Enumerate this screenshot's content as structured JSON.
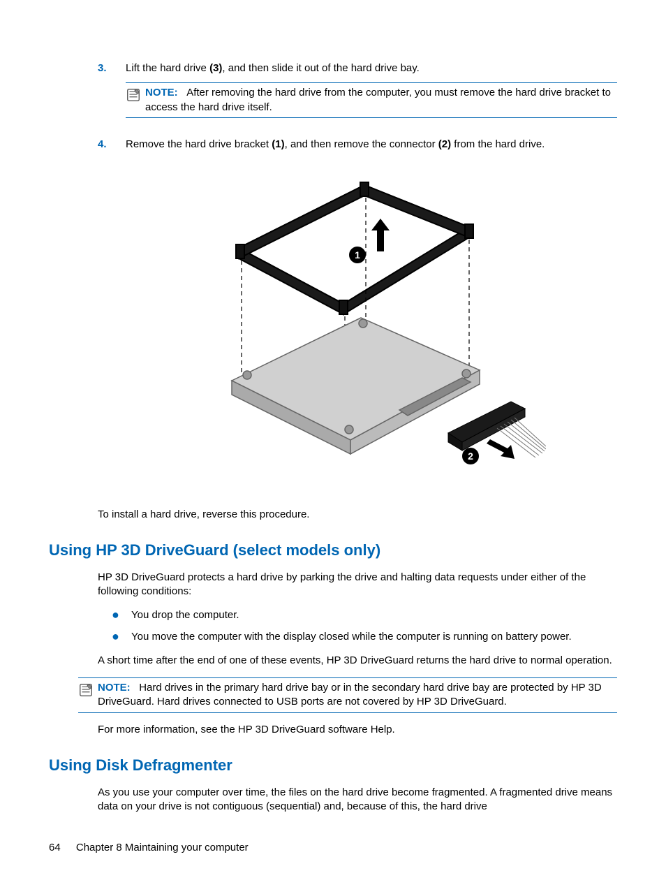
{
  "step3": {
    "num": "3.",
    "text_a": "Lift the hard drive ",
    "bold_a": "(3)",
    "text_b": ", and then slide it out of the hard drive bay."
  },
  "note1": {
    "label": "NOTE:",
    "text": "After removing the hard drive from the computer, you must remove the hard drive bracket to access the hard drive itself."
  },
  "step4": {
    "num": "4.",
    "text_a": "Remove the hard drive bracket ",
    "bold_a": "(1)",
    "text_b": ", and then remove the connector ",
    "bold_b": "(2)",
    "text_c": " from the hard drive."
  },
  "install_note": "To install a hard drive, reverse this procedure.",
  "heading1": "Using HP 3D DriveGuard (select models only)",
  "dg_intro": "HP 3D DriveGuard protects a hard drive by parking the drive and halting data requests under either of the following conditions:",
  "dg_b1": "You drop the computer.",
  "dg_b2": "You move the computer with the display closed while the computer is running on battery power.",
  "dg_after": "A short time after the end of one of these events, HP 3D DriveGuard returns the hard drive to normal operation.",
  "note2": {
    "label": "NOTE:",
    "text": "Hard drives in the primary hard drive bay or in the secondary hard drive bay are protected by HP 3D DriveGuard. Hard drives connected to USB ports are not covered by HP 3D DriveGuard."
  },
  "dg_more": "For more information, see the HP 3D DriveGuard software Help.",
  "heading2": "Using Disk Defragmenter",
  "defrag": "As you use your computer over time, the files on the hard drive become fragmented. A fragmented drive means data on your drive is not contiguous (sequential) and, because of this, the hard drive",
  "footer": {
    "page": "64",
    "chapter": "Chapter 8   Maintaining your computer"
  }
}
